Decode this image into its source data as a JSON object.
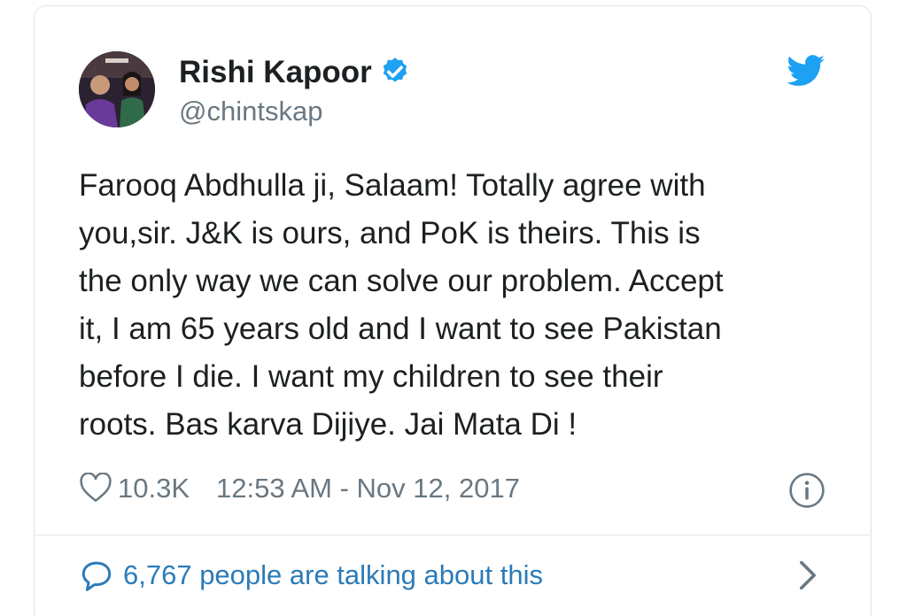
{
  "author": {
    "display_name": "Rishi Kapoor",
    "handle": "@chintskap",
    "avatar_icon": "profile-photo",
    "verified_icon": "verified-badge-icon"
  },
  "tweet": {
    "lines": [
      "Farooq Abdhulla ji, Salaam! Totally agree with",
      "you,sir. J&K is ours, and PoK is theirs. This is",
      "the only way we can solve our problem.  Accept",
      "it, I am 65 years old and I want to see Pakistan",
      "before I die. I want my children to see their",
      "roots. Bas karva Dijiye. Jai Mata Di !"
    ]
  },
  "meta": {
    "likes": "10.3K",
    "timestamp": "12:53 AM - Nov 12, 2017"
  },
  "conversation": {
    "label": "6,767 people are talking about this"
  },
  "colors": {
    "twitter_blue": "#1da1f2",
    "link_blue": "#2b7bb9",
    "text": "#1c2022",
    "muted": "#697882"
  }
}
